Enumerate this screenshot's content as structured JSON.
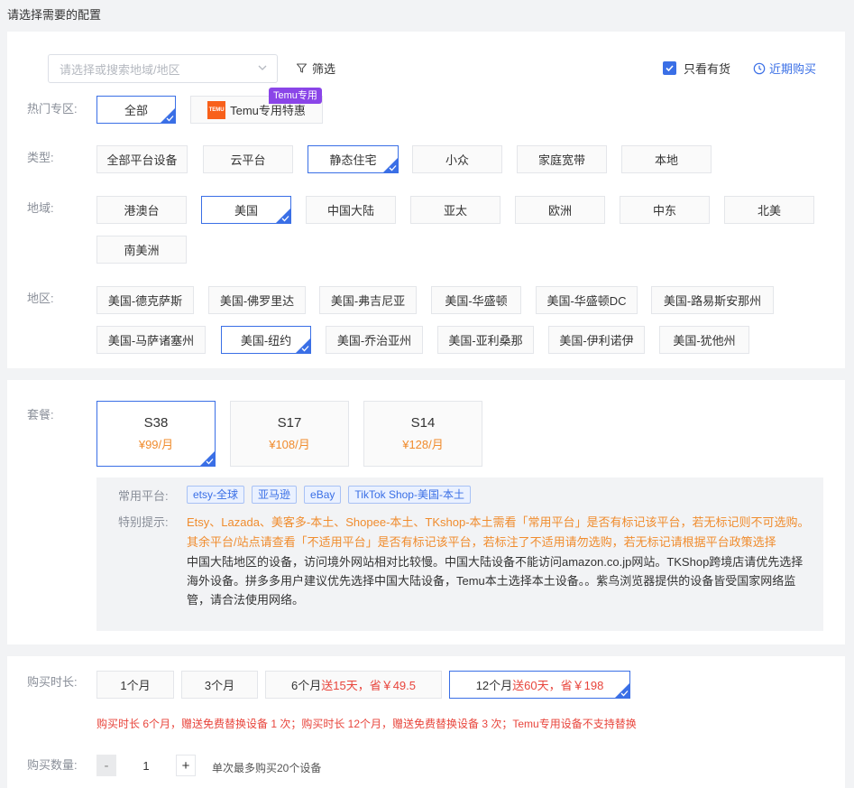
{
  "page_title": "请选择需要的配置",
  "filter_bar": {
    "region_placeholder": "请选择或搜索地域/地区",
    "filter_label": "筛选",
    "in_stock_label": "只看有货",
    "in_stock_checked": true,
    "recent_label": "近期购买"
  },
  "hot_zone": {
    "label": "热门专区:",
    "options": [
      "全部",
      "Temu专用特惠"
    ],
    "selected": "全部",
    "temu_badge": "Temu专用",
    "temu_logo_text": "TEMU"
  },
  "type": {
    "label": "类型:",
    "options": [
      "全部平台设备",
      "云平台",
      "静态住宅",
      "小众",
      "家庭宽带",
      "本地"
    ],
    "selected": "静态住宅"
  },
  "geo": {
    "label": "地域:",
    "options": [
      "港澳台",
      "美国",
      "中国大陆",
      "亚太",
      "欧洲",
      "中东",
      "北美",
      "南美洲"
    ],
    "selected": "美国"
  },
  "area": {
    "label": "地区:",
    "options": [
      "美国-德克萨斯",
      "美国-佛罗里达",
      "美国-弗吉尼亚",
      "美国-华盛顿",
      "美国-华盛顿DC",
      "美国-路易斯安那州",
      "美国-马萨诸塞州",
      "美国-纽约",
      "美国-乔治亚州",
      "美国-亚利桑那",
      "美国-伊利诺伊",
      "美国-犹他州"
    ],
    "selected": "美国-纽约"
  },
  "plan": {
    "label": "套餐:",
    "options": [
      {
        "name": "S38",
        "price": "¥99/月"
      },
      {
        "name": "S17",
        "price": "¥108/月"
      },
      {
        "name": "S14",
        "price": "¥128/月"
      }
    ],
    "selected": "S38"
  },
  "platforms": {
    "label": "常用平台:",
    "tags": [
      "etsy-全球",
      "亚马逊",
      "eBay",
      "TikTok Shop-美国-本土"
    ]
  },
  "tips": {
    "label": "特别提示:",
    "orange_line1": "Etsy、Lazada、美客多-本土、Shopee-本土、TKshop-本土需看「常用平台」是否有标记该平台，若无标记则不可选购。",
    "orange_line2": "其余平台/站点请查看「不适用平台」是否有标记该平台，若标注了不适用请勿选购，若无标记请根据平台政策选择",
    "dark_text": "中国大陆地区的设备，访问境外网站相对比较慢。中国大陆设备不能访问amazon.co.jp网站。TKShop跨境店请优先选择海外设备。拼多多用户建议优先选择中国大陆设备，Temu本土选择本土设备。。紫鸟浏览器提供的设备皆受国家网络监管，请合法使用网络。"
  },
  "duration": {
    "label": "购买时长:",
    "options": [
      {
        "base": "1个月",
        "promo": ""
      },
      {
        "base": "3个月",
        "promo": ""
      },
      {
        "base": "6个月",
        "promo": "送15天，省￥49.5"
      },
      {
        "base": "12个月",
        "promo": "送60天，省￥198"
      }
    ],
    "selected": "12个月",
    "note": "购买时长 6个月，赠送免费替换设备 1 次；购买时长 12个月，赠送免费替换设备 3 次；Temu专用设备不支持替换"
  },
  "quantity": {
    "label": "购买数量:",
    "minus": "-",
    "plus": "+",
    "value": "1",
    "note": "单次最多购买20个设备"
  },
  "colors": {
    "primary": "#3a6fe6",
    "orange": "#f08c2e",
    "red": "#e8453c",
    "temu": "#f8601a",
    "badge_purple": "#8a45e8"
  }
}
